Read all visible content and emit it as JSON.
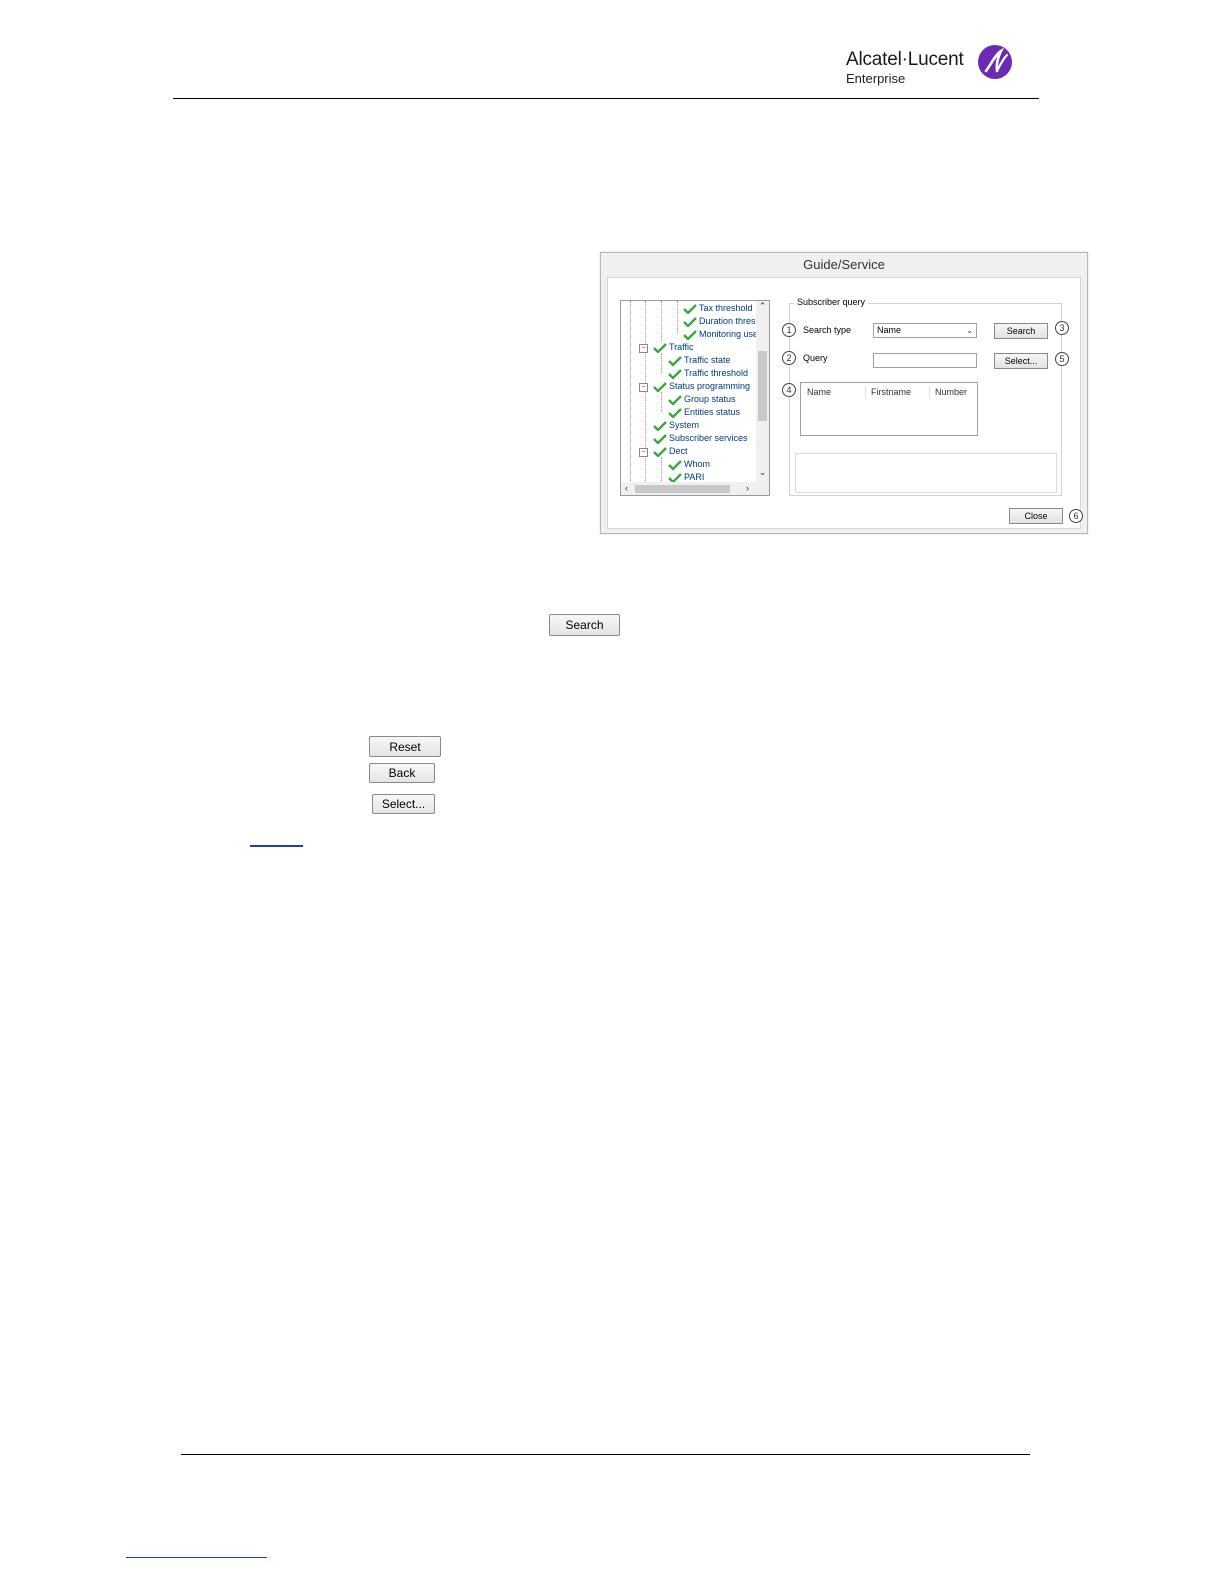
{
  "header": {
    "brand_name": "Alcatel·Lucent",
    "brand_sub": "Enterprise"
  },
  "dialog": {
    "title": "Guide/Service",
    "tree": [
      {
        "label": "Tax threshold",
        "level": 3
      },
      {
        "label": "Duration thres",
        "level": 3
      },
      {
        "label": "Monitoring use",
        "level": 3
      },
      {
        "label": "Traffic",
        "level": 1
      },
      {
        "label": "Traffic state",
        "level": 2
      },
      {
        "label": "Traffic threshold",
        "level": 2
      },
      {
        "label": "Status programming",
        "level": 1
      },
      {
        "label": "Group status",
        "level": 2
      },
      {
        "label": "Entities status",
        "level": 2
      },
      {
        "label": "System",
        "level": 1
      },
      {
        "label": "Subscriber services",
        "level": 1
      },
      {
        "label": "Dect",
        "level": 1
      },
      {
        "label": "Whom",
        "level": 2
      },
      {
        "label": "PARI",
        "level": 2
      }
    ],
    "group_title": "Subscriber query",
    "search_type_label": "Search type",
    "search_type_value": "Name",
    "query_label": "Query",
    "search_button": "Search",
    "select_button": "Select...",
    "close_button": "Close",
    "columns": [
      "Name",
      "Firstname",
      "Number"
    ],
    "callouts": [
      "1",
      "2",
      "3",
      "4",
      "5",
      "6"
    ]
  },
  "doc_buttons": {
    "search": "Search",
    "reset": "Reset",
    "back": "Back",
    "select": "Select..."
  }
}
